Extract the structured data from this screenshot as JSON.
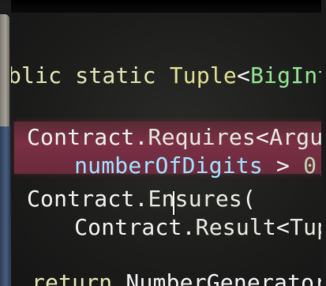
{
  "editor": {
    "lines": [
      {
        "id": "l1",
        "parts": [
          {
            "t": "blic static ",
            "c": "tk-kw"
          },
          {
            "t": "Tuple",
            "c": "tk-yellow"
          },
          {
            "t": "<",
            "c": "tk-plain"
          },
          {
            "t": "BigInt",
            "c": "tk-green"
          }
        ]
      },
      {
        "id": "l2",
        "parts": [
          {
            "t": "Contract",
            "c": "tk-plain"
          },
          {
            "t": ".",
            "c": "tk-plain"
          },
          {
            "t": "Requires",
            "c": "tk-method"
          },
          {
            "t": "<",
            "c": "tk-plain"
          },
          {
            "t": "Argum",
            "c": "tk-method"
          }
        ]
      },
      {
        "id": "l3",
        "parts": [
          {
            "t": "  numberOfDigits",
            "c": "tk-param"
          },
          {
            "t": " > ",
            "c": "tk-plain"
          },
          {
            "t": "0",
            "c": "tk-num"
          },
          {
            "t": ",",
            "c": "tk-plain"
          }
        ]
      },
      {
        "id": "l4",
        "parts": [
          {
            "t": "Contract",
            "c": "tk-plain"
          },
          {
            "t": ".",
            "c": "tk-plain"
          },
          {
            "t": "Ensures",
            "c": "tk-method"
          },
          {
            "t": "(",
            "c": "tk-plain"
          }
        ]
      },
      {
        "id": "l5",
        "parts": [
          {
            "t": "  Contract",
            "c": "tk-plain"
          },
          {
            "t": ".",
            "c": "tk-plain"
          },
          {
            "t": "Result",
            "c": "tk-method"
          },
          {
            "t": "<",
            "c": "tk-plain"
          },
          {
            "t": "Tupl",
            "c": "tk-method"
          }
        ]
      },
      {
        "id": "l6",
        "parts": [
          {
            "t": "return ",
            "c": "tk-kw"
          },
          {
            "t": "NumberGenerator",
            "c": "tk-plain"
          }
        ]
      }
    ]
  }
}
